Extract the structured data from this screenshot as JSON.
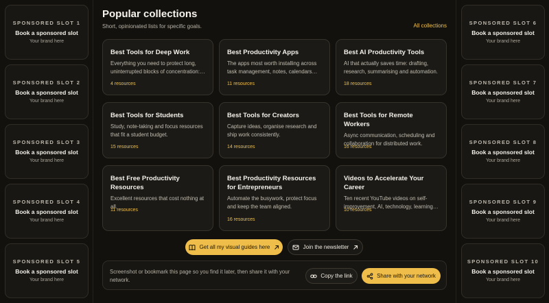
{
  "left_slots": [
    {
      "label": "SPONSORED SLOT 1",
      "cta": "Book a sponsored slot",
      "sub": "Your brand here"
    },
    {
      "label": "SPONSORED SLOT 2",
      "cta": "Book a sponsored slot",
      "sub": "Your brand here"
    },
    {
      "label": "SPONSORED SLOT 3",
      "cta": "Book a sponsored slot",
      "sub": "Your brand here"
    },
    {
      "label": "SPONSORED SLOT 4",
      "cta": "Book a sponsored slot",
      "sub": "Your brand here"
    },
    {
      "label": "SPONSORED SLOT 5",
      "cta": "Book a sponsored slot",
      "sub": "Your brand here"
    }
  ],
  "right_slots": [
    {
      "label": "SPONSORED SLOT 6",
      "cta": "Book a sponsored slot",
      "sub": "Your brand here"
    },
    {
      "label": "SPONSORED SLOT 7",
      "cta": "Book a sponsored slot",
      "sub": "Your brand here"
    },
    {
      "label": "SPONSORED SLOT 8",
      "cta": "Book a sponsored slot",
      "sub": "Your brand here"
    },
    {
      "label": "SPONSORED SLOT 9",
      "cta": "Book a sponsored slot",
      "sub": "Your brand here"
    },
    {
      "label": "SPONSORED SLOT 10",
      "cta": "Book a sponsored slot",
      "sub": "Your brand here"
    }
  ],
  "main": {
    "title": "Popular collections",
    "subtitle": "Short, opinionated lists for specific goals.",
    "all_link": "All collections",
    "cards": [
      {
        "title": "Best Tools for Deep Work",
        "desc": "Everything you need to protect long, uninterrupted blocks of concentration: focus apps, noise control and more.",
        "count": "4 resources"
      },
      {
        "title": "Best Productivity Apps",
        "desc": "The apps most worth installing across task management, notes, calendars and automation.",
        "count": "11 resources"
      },
      {
        "title": "Best AI Productivity Tools",
        "desc": "AI that actually saves time: drafting, research, summarising and automation.",
        "count": "18 resources"
      },
      {
        "title": "Best Tools for Students",
        "desc": "Study, note-taking and focus resources that fit a student budget.",
        "count": "15 resources"
      },
      {
        "title": "Best Tools for Creators",
        "desc": "Capture ideas, organise research and ship work consistently.",
        "count": "14 resources"
      },
      {
        "title": "Best Tools for Remote Workers",
        "desc": "Async communication, scheduling and collaboration for distributed work.",
        "count": "16 resources"
      },
      {
        "title": "Best Free Productivity Resources",
        "desc": "Excellent resources that cost nothing at all.",
        "count": "11 resources"
      },
      {
        "title": "Best Productivity Resources for Entrepreneurs",
        "desc": "Automate the busywork, protect focus and keep the team aligned.",
        "count": "16 resources"
      },
      {
        "title": "Videos to Accelerate Your Career",
        "desc": "Ten recent YouTube videos on self-improvement, AI, technology, learning and careers.",
        "count": "10 resources"
      }
    ],
    "guides_button": "Get all my visual guides here",
    "newsletter_button": "Join the newsletter"
  },
  "share": {
    "text": "Screenshot or bookmark this page so you find it later, then share it with your network.",
    "copy_button": "Copy the link",
    "share_button": "Share with your network"
  },
  "colors": {
    "accent": "#efbe4a",
    "background": "#12110e",
    "card": "#1b1a16"
  },
  "icons": {
    "guides": "book-icon",
    "guides_arrow": "arrow-up-right-icon",
    "newsletter": "mail-icon",
    "newsletter_arrow": "arrow-up-right-icon",
    "copy": "link-icon",
    "share": "share-icon"
  }
}
